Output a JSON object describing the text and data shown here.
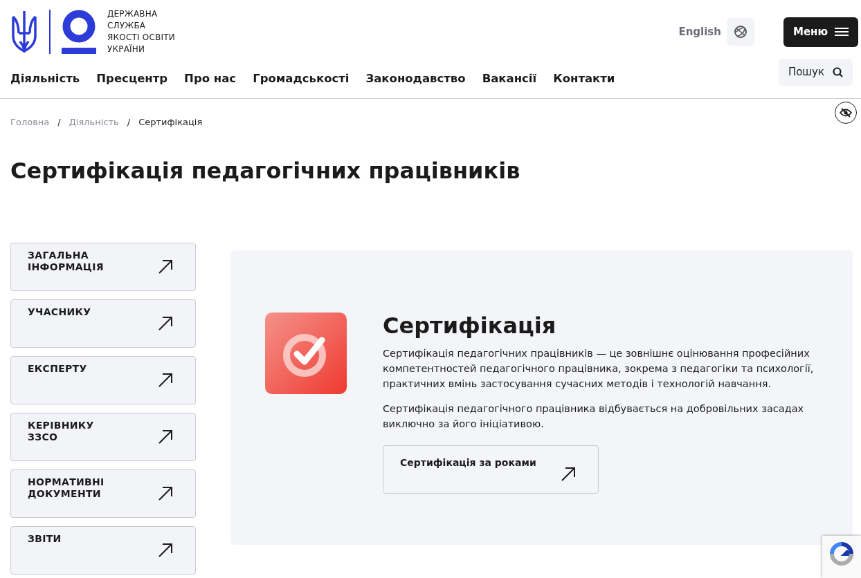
{
  "logo": {
    "lines": [
      "ДЕРЖАВНА",
      "СЛУЖБА",
      "ЯКОСТІ ОСВІТИ",
      "УКРАЇНИ"
    ]
  },
  "language": {
    "label": "English"
  },
  "menu_button": {
    "label": "Меню"
  },
  "nav": [
    {
      "label": "Діяльність"
    },
    {
      "label": "Пресцентр"
    },
    {
      "label": "Про нас"
    },
    {
      "label": "Громадськості"
    },
    {
      "label": "Законодавство"
    },
    {
      "label": "Вакансії"
    },
    {
      "label": "Контакти"
    }
  ],
  "search": {
    "label": "Пошук"
  },
  "breadcrumbs": [
    {
      "label": "Головна",
      "current": false
    },
    {
      "label": "Діяльність",
      "current": false
    },
    {
      "label": "Сертифікація",
      "current": true
    }
  ],
  "breadcrumb_separator": "/",
  "page_title": "Сертифікація педагогічних працівників",
  "sidebar": {
    "items": [
      {
        "label": "ЗАГАЛЬНА ІНФОРМАЦІЯ"
      },
      {
        "label": "УЧАСНИКУ"
      },
      {
        "label": "ЕКСПЕРТУ"
      },
      {
        "label": "КЕРІВНИКУ ЗЗСО"
      },
      {
        "label": "НОРМАТИВНІ ДОКУМЕНТИ"
      },
      {
        "label": "ЗВІТИ"
      }
    ]
  },
  "card": {
    "title": "Сертифікація",
    "paragraphs": [
      "Сертифікація педагогічних працівників — це зовнішнє оцінювання професійних компетентностей педагогічного працівника, зокрема з педагогіки та психології, практичних вмінь застосування сучасних методів і технологій навчання.",
      "Сертифікація педагогічного працівника відбувається на добровільних засадах виключно за його ініціативою."
    ],
    "link_button": {
      "label": "Сертифікація за роками"
    }
  }
}
